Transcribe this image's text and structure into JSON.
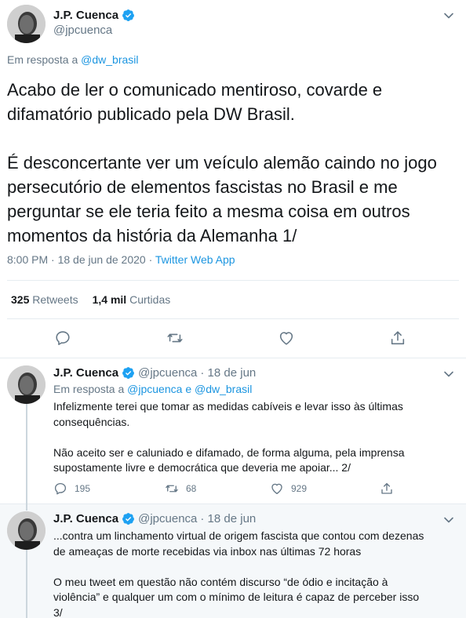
{
  "main_tweet": {
    "author_name": "J.P. Cuenca",
    "author_handle": "@jpcuenca",
    "reply_prefix": "Em resposta a",
    "reply_to": "@dw_brasil",
    "text": "Acabo de ler o comunicado mentiroso, covarde e\ndifamatório publicado pela DW Brasil.\n\nÉ desconcertante ver um veículo alemão caindo no jogo\npersecutório de elementos fascistas no Brasil e me\nperguntar se ele teria feito a mesma coisa em outros\nmomentos da história da Alemanha 1/",
    "timestamp": "8:00 PM · 18 de jun de 2020 ·",
    "source": "Twitter Web App",
    "retweets_count": "325",
    "retweets_label": "Retweets",
    "likes_count": "1,4 mil",
    "likes_label": "Curtidas",
    "icons": [
      "verified-badge-icon",
      "chevron-down-icon",
      "reply-icon",
      "retweet-icon",
      "like-icon",
      "share-icon"
    ]
  },
  "replies": [
    {
      "author_name": "J.P. Cuenca",
      "author_handle": "@jpcuenca",
      "date": "· 18 de jun",
      "reply_prefix": "Em resposta a",
      "reply_to_1": "@jpcuenca",
      "reply_conj": "e",
      "reply_to_2": "@dw_brasil",
      "text": "Infelizmente terei que tomar as medidas cabíveis e levar isso às últimas\nconsequências.\n\nNão aceito ser e caluniado e difamado, de forma alguma, pela imprensa\nsupostamente livre e democrática que deveria me apoiar... 2/",
      "reply_count": "195",
      "retweet_count": "68",
      "like_count": "929"
    },
    {
      "author_name": "J.P. Cuenca",
      "author_handle": "@jpcuenca",
      "date": "· 18 de jun",
      "text": "...contra um linchamento virtual de origem fascista que contou com dezenas\nde ameaças de morte recebidas via inbox nas últimas 72 horas\n\nO meu tweet em questão não contém discurso “de ódio e incitação à\nviolência” e qualquer um com o mínimo de leitura é capaz de perceber isso\n3/"
    }
  ],
  "colors": {
    "link": "#1b95e0",
    "secondary_text": "#657786",
    "primary_text": "#14171a",
    "verified": "#1da1f2",
    "border": "#e6ecf0",
    "thread_line": "#ccd6dd"
  }
}
